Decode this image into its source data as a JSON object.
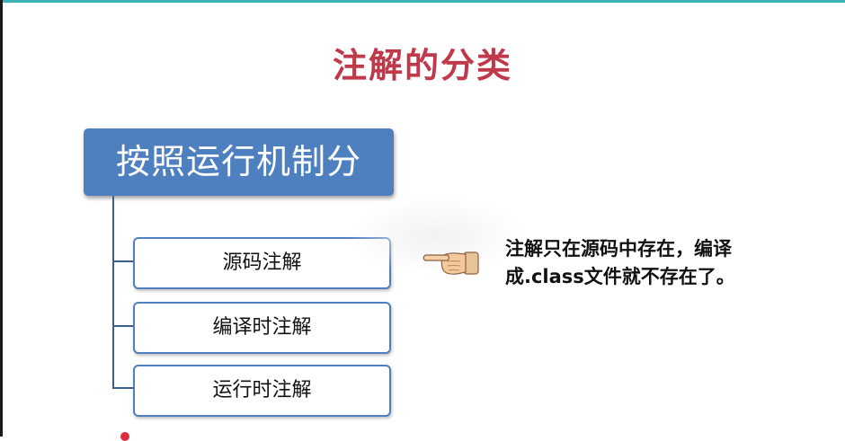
{
  "slide": {
    "title": "注解的分类",
    "root_label": "按照运行机制分",
    "children": [
      {
        "label": "源码注解"
      },
      {
        "label": "编译时注解"
      },
      {
        "label": "运行时注解"
      }
    ],
    "note": "注解只在源码中存在，编译成.class文件就不存在了。",
    "pointer_icon": "pointing-hand-icon"
  },
  "colors": {
    "title": "#c0394b",
    "root_fill": "#4e7fbf",
    "child_border": "#4e7fbf",
    "connector": "#3b5f8f",
    "top_rule": "#3bb3b5"
  }
}
